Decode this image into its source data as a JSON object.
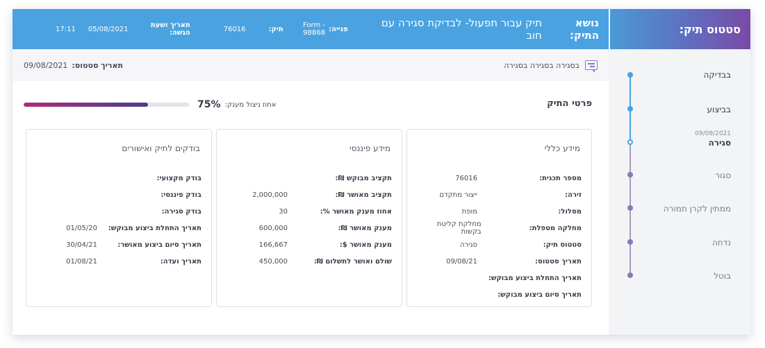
{
  "sidebar": {
    "title": "סטטוס תיק:",
    "steps": [
      {
        "label": "בבדיקה",
        "date": ""
      },
      {
        "label": "בביצוע",
        "date": ""
      },
      {
        "label": "סגירה",
        "date": "09/08/2021"
      },
      {
        "label": "סגור",
        "date": ""
      },
      {
        "label": "ממתין לקרן תמורה",
        "date": ""
      },
      {
        "label": "נדחה",
        "date": ""
      },
      {
        "label": "בוטל",
        "date": ""
      }
    ]
  },
  "header": {
    "subject_label": "נושא התיק:",
    "subject_value": "תיק עבור תפעול- לבדיקת סגירה עם חוב",
    "request_label": "פנייה:",
    "request_value": "Form - 98868",
    "case_label": "תיק:",
    "case_value": "76016",
    "submitted_label": "תאריך ושעת הגשה:",
    "submitted_date": "05/08/2021",
    "submitted_time": "17:11"
  },
  "statusbar": {
    "status_text": "בסגירה בסגירה בסגירה",
    "status_date_label": "תאריך סטטוס:",
    "status_date_value": "09/08/2021"
  },
  "details": {
    "title": "פרטי התיק",
    "progress_label": "אחוז ניצול מענק:",
    "progress_text": "75%",
    "progress_value": 0.75
  },
  "cards": {
    "general": {
      "title": "מידע כללי",
      "rows": [
        {
          "k": "מספר תכנית:",
          "v": "76016"
        },
        {
          "k": "זירה:",
          "v": "ייצור מתקדם"
        },
        {
          "k": "מסלול:",
          "v": "מופת"
        },
        {
          "k": "מחלקה מטפלת:",
          "v": "מחלקת קליטת בקשות"
        },
        {
          "k": "סטטוס תיק:",
          "v": "סגירה"
        },
        {
          "k": "תאריך סטטוס:",
          "v": "09/08/21"
        },
        {
          "k": "תאריך התחלת ביצוע מבוקש:",
          "v": ""
        },
        {
          "k": "תאריך סיום ביצוע מבוקש:",
          "v": ""
        }
      ]
    },
    "financial": {
      "title": "מידע פיננסי",
      "rows": [
        {
          "k": "תקציב מבוקש ₪:",
          "v": ""
        },
        {
          "k": "תקציב מאושר ₪:",
          "v": "2,000,000"
        },
        {
          "k": "אחוז מענק מאושר %:",
          "v": "30"
        },
        {
          "k": "מענק מאושר ₪:",
          "v": "600,000"
        },
        {
          "k": "מענק מאושר $:",
          "v": "166,667"
        },
        {
          "k": "שולם ואושר לתשלום ₪:",
          "v": "450,000"
        }
      ]
    },
    "reviewers": {
      "title": "בודקים לתיק ואישורים",
      "rows": [
        {
          "k": "בודק מקצועי:",
          "v": ""
        },
        {
          "k": "בודק פיננסי:",
          "v": ""
        },
        {
          "k": "בודק סגירה:",
          "v": ""
        },
        {
          "k": "תאריך התחלת ביצוע מבוקש:",
          "v": "01/05/20"
        },
        {
          "k": "תאריך סיום ביצוע מאושר:",
          "v": "30/04/21"
        },
        {
          "k": "תאריך ועדה:",
          "v": "01/08/21"
        }
      ]
    }
  },
  "colors": {
    "header_blue": "#4aa3e0",
    "accent_purple": "#7a4aa6",
    "progress_magenta": "#b02a7c"
  }
}
